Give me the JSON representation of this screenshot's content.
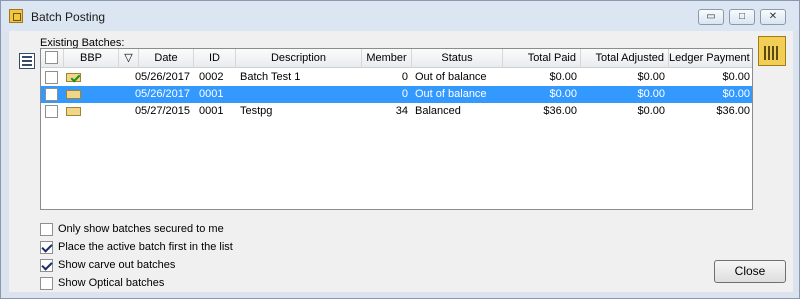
{
  "window": {
    "title": "Batch Posting",
    "title_icon": "batch-posting-app-icon",
    "minimize": "▭",
    "maximize": "□",
    "close": "✕"
  },
  "section_label": "Existing Batches:",
  "grid": {
    "columns": [
      "",
      "BBP",
      "▽",
      "Date",
      "ID",
      "Description",
      "Member",
      "Status",
      "Total Paid",
      "Total Adjusted",
      "Ledger Payment"
    ],
    "rows": [
      {
        "date": "05/26/2017",
        "id": "0002",
        "description": "Batch Test 1",
        "member": "0",
        "status": "Out of balance",
        "total_paid": "$0.00",
        "total_adjusted": "$0.00",
        "ledger_payment": "$0.00",
        "icon": "green-check-batch-icon",
        "selected": false
      },
      {
        "date": "05/26/2017",
        "id": "0001",
        "description": "",
        "member": "0",
        "status": "Out of balance",
        "total_paid": "$0.00",
        "total_adjusted": "$0.00",
        "ledger_payment": "$0.00",
        "icon": "batch-icon",
        "selected": true
      },
      {
        "date": "05/27/2015",
        "id": "0001",
        "description": "Testpg",
        "member": "34",
        "status": "Balanced",
        "total_paid": "$36.00",
        "total_adjusted": "$0.00",
        "ledger_payment": "$36.00",
        "icon": "batch-icon",
        "selected": false
      }
    ]
  },
  "scrollbar": {
    "left": "◀",
    "right": "▶"
  },
  "options": [
    {
      "label": "Only show batches secured to me",
      "checked": false
    },
    {
      "label": "Place the active batch first in the list",
      "checked": true
    },
    {
      "label": "Show carve out batches",
      "checked": true
    },
    {
      "label": "Show Optical batches",
      "checked": false
    }
  ],
  "close_label": "Close",
  "colors": {
    "selected_row": "#3399ff",
    "window_frame": "#dbe3ee",
    "client": "#f0f0f0"
  }
}
